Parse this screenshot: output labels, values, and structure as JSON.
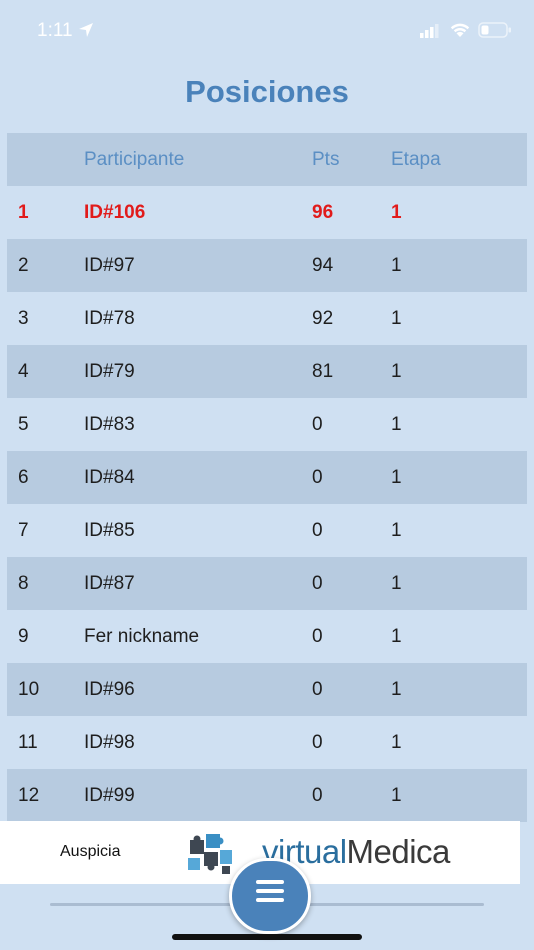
{
  "status_bar": {
    "time": "1:11",
    "icons": [
      "location-arrow-icon",
      "cellular-signal-icon",
      "wifi-icon",
      "battery-icon"
    ]
  },
  "title": "Posiciones",
  "table": {
    "headers": {
      "pos": "",
      "participant": "Participante",
      "pts": "Pts",
      "etapa": "Etapa"
    },
    "rows": [
      {
        "pos": "1",
        "participant": "ID#106",
        "pts": "96",
        "etapa": "1",
        "highlight": true
      },
      {
        "pos": "2",
        "participant": "ID#97",
        "pts": "94",
        "etapa": "1"
      },
      {
        "pos": "3",
        "participant": "ID#78",
        "pts": "92",
        "etapa": "1"
      },
      {
        "pos": "4",
        "participant": "ID#79",
        "pts": "81",
        "etapa": "1"
      },
      {
        "pos": "5",
        "participant": "ID#83",
        "pts": "0",
        "etapa": "1"
      },
      {
        "pos": "6",
        "participant": "ID#84",
        "pts": "0",
        "etapa": "1"
      },
      {
        "pos": "7",
        "participant": "ID#85",
        "pts": "0",
        "etapa": "1"
      },
      {
        "pos": "8",
        "participant": "ID#87",
        "pts": "0",
        "etapa": "1"
      },
      {
        "pos": "9",
        "participant": "Fer nickname",
        "pts": "0",
        "etapa": "1"
      },
      {
        "pos": "10",
        "participant": "ID#96",
        "pts": "0",
        "etapa": "1"
      },
      {
        "pos": "11",
        "participant": "ID#98",
        "pts": "0",
        "etapa": "1"
      },
      {
        "pos": "12",
        "participant": "ID#99",
        "pts": "0",
        "etapa": "1"
      }
    ]
  },
  "ad": {
    "label": "Auspicia",
    "brand_prefix": "virtual",
    "brand_suffix": "Medica",
    "logo_icon": "puzzle-pieces-icon"
  },
  "menu_button": {
    "icon": "hamburger-menu-icon"
  },
  "colors": {
    "background": "#cfe0f2",
    "stripe": "#b7cbe0",
    "accent": "#4a82ba",
    "leader": "#e11b1b"
  }
}
